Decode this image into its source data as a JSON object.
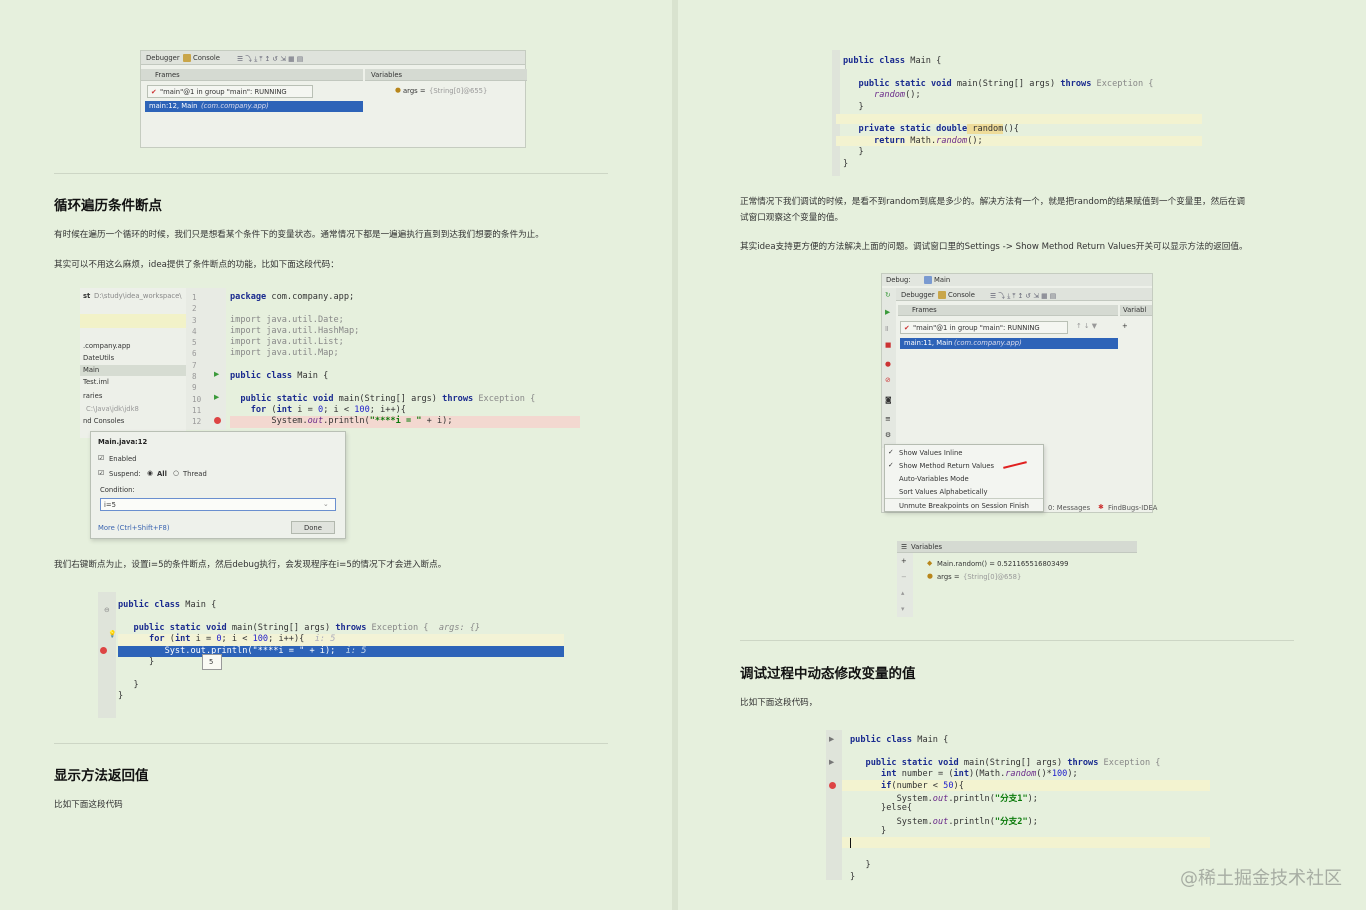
{
  "left": {
    "img1": {
      "toolbar": [
        "Debugger",
        "Console"
      ],
      "frames_label": "Frames",
      "variables_label": "Variables",
      "thread": "\"main\"@1 in group \"main\": RUNNING",
      "frame": "main:12, Main",
      "frame_pkg": "(com.company.app)",
      "var": "args = ",
      "var_val": "{String[0]@655}"
    },
    "s1": {
      "title": "循环遍历条件断点",
      "p1": "有时候在遍历一个循环的时候，我们只是想看某个条件下的变量状态。通常情况下都是一遍遍执行直到到达我们想要的条件为止。",
      "p2": "其实可以不用这么麻烦，idea提供了条件断点的功能，比如下面这段代码："
    },
    "img2": {
      "project_path": "D:\\study\\idea_workspace\\",
      "project_prefix": "st",
      "tree": [
        ".company.app",
        "DateUtils",
        "Main",
        "Test.iml",
        "raries",
        "C:\\Java\\jdk\\jdk8",
        "nd Consoles"
      ],
      "lines": [
        "1",
        "2",
        "3",
        "4",
        "5",
        "6",
        "7",
        "8",
        "9",
        "10",
        "11",
        "12"
      ],
      "code": {
        "pkg_kw": "package",
        "pkg": " com.company.app;",
        "imp_kw": "import",
        "imp1": " java.util.Date;",
        "imp2": " java.util.HashMap;",
        "imp3": " java.util.List;",
        "imp4": " java.util.Map;",
        "cls_kw": "public class",
        "cls": " Main {",
        "main_kw": "public static void",
        "main": " main(String[] args) ",
        "throws": "throws",
        "exc": " Exception {",
        "for_kw": "for",
        "for_a": " (",
        "int": "int",
        "for_b": " i = ",
        "zero": "0",
        "for_c": "; i < ",
        "hund": "100",
        "for_d": "; i++){",
        "print_a": "System.",
        "print_out": "out",
        "print_b": ".println(",
        "print_str": "\"****i = \"",
        "print_c": " + i);"
      },
      "popup": {
        "title": "Main.java:12",
        "enabled": "Enabled",
        "suspend": "Suspend:",
        "all": "All",
        "thread": "Thread",
        "condition": "Condition:",
        "condition_value": "i=5",
        "more": "More (Ctrl+Shift+F8)",
        "done": "Done"
      }
    },
    "p3": "我们右键断点为止，设置i=5的条件断点，然后debug执行，会发现程序在i=5的情况下才会进入断点。",
    "img3": {
      "cls_kw": "public class",
      "cls": " Main {",
      "main_kw": "public static void",
      "main": " main(String[] args) ",
      "throws": "throws",
      "exc": " Exception {",
      "hint1": "args: {}",
      "for_kw": "for",
      "for_a": " (",
      "int": "int",
      "for_b": " i = ",
      "zero": "0",
      "for_c": "; i < ",
      "hund": "100",
      "for_d": "; i++){",
      "hint2": "i: 5",
      "print": "Syst",
      "print_b": ".out.println(\"****i = \" + i);",
      "hint3": "i: 5",
      "b1": "}",
      "b2": "}",
      "b3": "}",
      "tooltip": "5"
    },
    "s2": {
      "title": "显示方法返回值",
      "p1": "比如下面这段代码"
    }
  },
  "right": {
    "code1": {
      "cls_kw": "public class",
      "cls": " Main {",
      "main_kw": "public static void",
      "main": " main(String[] args) ",
      "throws": "throws",
      "exc": " Exception {",
      "call": "random",
      "call_b": "();",
      "b1": "}",
      "priv_kw": "private static double",
      "rnd": " random",
      "rnd_b": "(){",
      "ret_kw": "return",
      "ret": " Math.",
      "ret_m": "random",
      "ret_b": "();",
      "b2": "}",
      "b3": "}"
    },
    "p1a": "正常情况下我们调试的时候，是看不到random到底是多少的。解决方法有一个，就是把random的结果赋值到一个变量里，然后在调",
    "p1b": "试窗口观察这个变量的值。",
    "p2": "其实idea支持更方便的方法解决上面的问题。调试窗口里的Settings -> Show Method Return Values开关可以显示方法的返回值。",
    "img4": {
      "debug": "Debug:",
      "tab": "Main",
      "toolbar": [
        "Debugger",
        "Console"
      ],
      "frames_label": "Frames",
      "variables_label": "Variabl",
      "thread": "\"main\"@1 in group \"main\": RUNNING",
      "frame": "main:11, Main",
      "frame_pkg": "(com.company.app)",
      "menu": [
        "Show Values Inline",
        "Show Method Return Values",
        "Auto-Variables Mode",
        "Sort Values Alphabetically",
        "Unmute Breakpoints on Session Finish"
      ],
      "messages": "0: Messages",
      "findbugs": "FindBugs-IDEA"
    },
    "img5": {
      "variables_label": "Variables",
      "v1": "Main.random() = 0.521165516803499",
      "v2": "args = ",
      "v2_val": "{String[0]@658}"
    },
    "s3": {
      "title": "调试过程中动态修改变量的值",
      "p1": "比如下面这段代码，"
    },
    "code2": {
      "cls_kw": "public class",
      "cls": " Main {",
      "main_kw": "public static void",
      "main": " main(String[] args) ",
      "throws": "throws",
      "exc": " Exception {",
      "int_kw": "int",
      "num_a": " number = (",
      "num_int": "int",
      "num_b": ")(Math.",
      "num_m": "random",
      "num_c": "()*",
      "num_h": "100",
      "num_d": ");",
      "if_kw": "if",
      "if_a": "(number < ",
      "fifty": "50",
      "if_b": "){",
      "p1a": "System.",
      "p1o": "out",
      "p1b": ".println(",
      "p1s": "\"分支1\"",
      "p1c": ");",
      "else": "}else{",
      "p2a": "System.",
      "p2o": "out",
      "p2b": ".println(",
      "p2s": "\"分支2\"",
      "p2c": ");",
      "b1": "}",
      "b2": "}",
      "b3": "}"
    },
    "watermark": "@稀土掘金技术社区"
  }
}
